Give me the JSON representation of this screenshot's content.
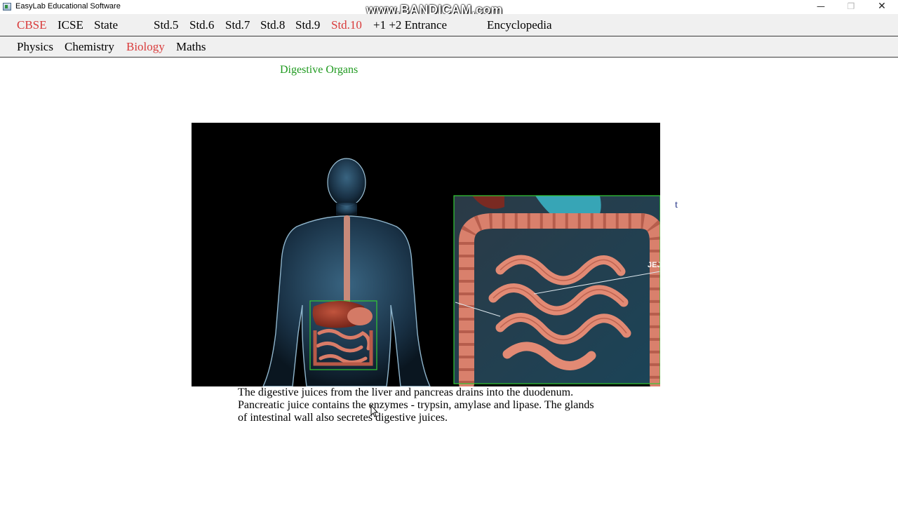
{
  "window": {
    "title": "EasyLab Educational Software",
    "watermark": "www.BANDICAM.com",
    "controls": {
      "minimize": "—",
      "maximize": "❐",
      "close": "✕"
    }
  },
  "board_menu": [
    {
      "label": "CBSE",
      "active": true
    },
    {
      "label": "ICSE",
      "active": false
    },
    {
      "label": "State",
      "active": false
    },
    {
      "label": "Std.5",
      "active": false
    },
    {
      "label": "Std.6",
      "active": false
    },
    {
      "label": "Std.7",
      "active": false
    },
    {
      "label": "Std.8",
      "active": false
    },
    {
      "label": "Std.9",
      "active": false
    },
    {
      "label": "Std.10",
      "active": true
    },
    {
      "label": "+1 +2 Entrance",
      "active": false
    },
    {
      "label": "Encyclopedia",
      "active": false
    }
  ],
  "subject_menu": [
    {
      "label": "Physics",
      "active": false
    },
    {
      "label": "Chemistry",
      "active": false
    },
    {
      "label": "Biology",
      "active": true
    },
    {
      "label": "Maths",
      "active": false
    }
  ],
  "content": {
    "title": "Digestive Organs",
    "inset_label": "JEJ",
    "stray_text": "t",
    "caption_lines": [
      "The digestive juices from the liver and pancreas drains into the duodenum.",
      "Pancreatic juice contains the enzymes - trypsin, amylase and lipase. The glands",
      "of intestinal wall also secretes digestive juices."
    ]
  },
  "colors": {
    "active_menu": "#d93a3a",
    "title_green": "#1f9a1f",
    "highlight_box": "#33cc33"
  }
}
